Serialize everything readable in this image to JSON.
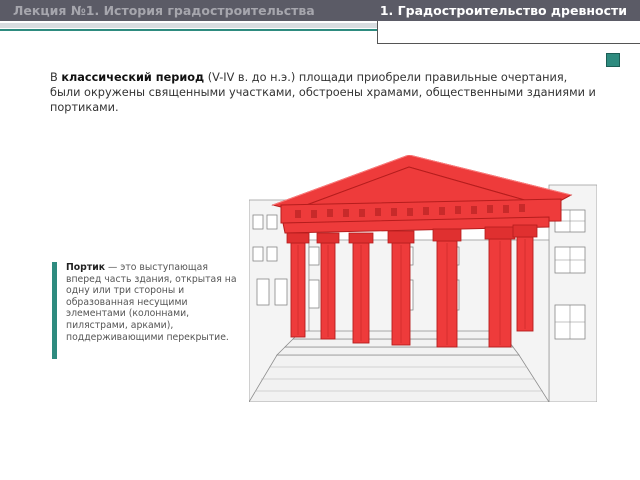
{
  "header": {
    "lecture_title": "Лекция №1. История градостроительства",
    "section_title": "1. Градостроительство древности"
  },
  "intro": {
    "lead": "В ",
    "term": "классический период",
    "rest": " (V-IV в. до н.э.) площади приобрели правильные очертания, были окружены священными участками, обстроены храмами, общественными зданиями и портиками."
  },
  "definition": {
    "term": "Портик",
    "text": " — это выступающая вперед часть здания, открытая на одну или три стороны и образованная несущими элементами (колоннами, пилястрами, арками), поддерживающими перекрытие."
  },
  "colors": {
    "header_bg": "#5b5b66",
    "accent": "#2e8b7f",
    "portico": "#ee3b3b"
  }
}
